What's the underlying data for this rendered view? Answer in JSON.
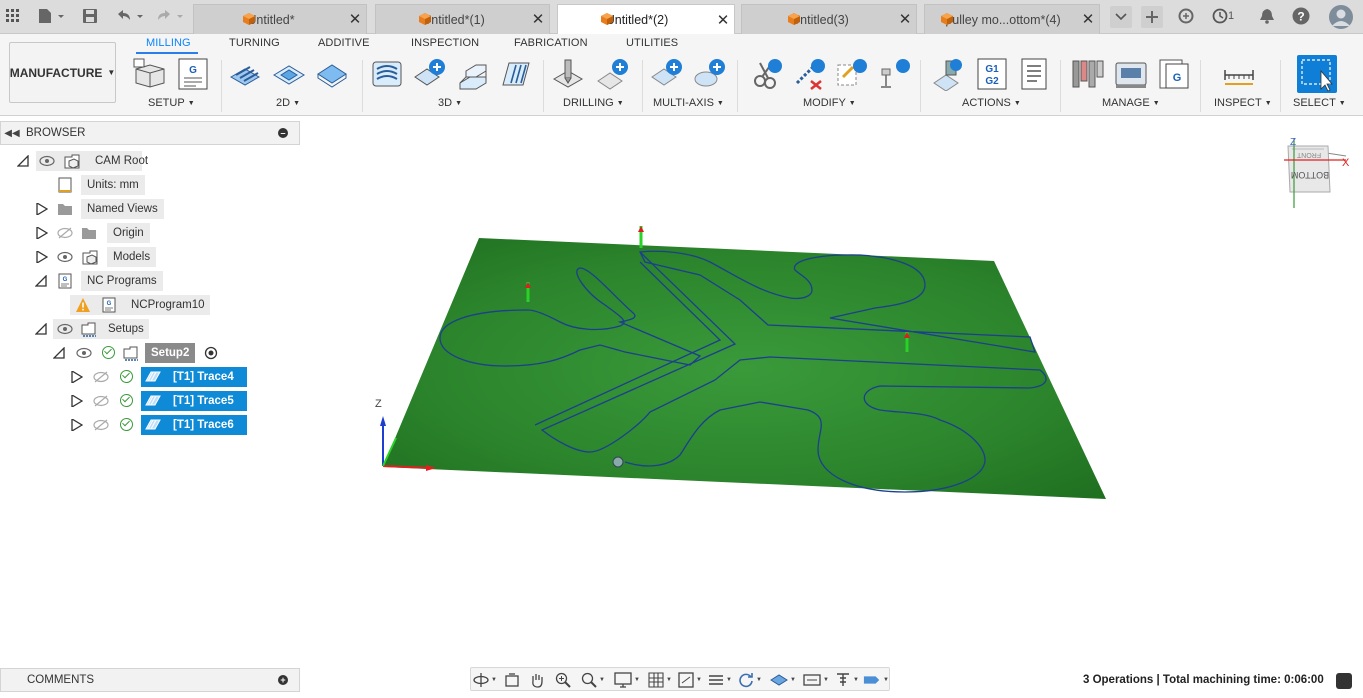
{
  "tabs": [
    {
      "label": "Untitled*",
      "active": false
    },
    {
      "label": "Untitled*(1)",
      "active": false
    },
    {
      "label": "Untitled*(2)",
      "active": true
    },
    {
      "label": "Untitled(3)",
      "active": false
    },
    {
      "label": "pulley mo...ottom*(4)",
      "active": false
    }
  ],
  "job_count": "1",
  "workspace": {
    "label": "MANUFACTURE"
  },
  "ribbon_tabs": [
    "MILLING",
    "TURNING",
    "ADDITIVE",
    "INSPECTION",
    "FABRICATION",
    "UTILITIES"
  ],
  "ribbon_active_tab": "MILLING",
  "groups": {
    "setup": "SETUP",
    "2d": "2D",
    "3d": "3D",
    "drilling": "DRILLING",
    "multiaxis": "MULTI-AXIS",
    "modify": "MODIFY",
    "actions": "ACTIONS",
    "manage": "MANAGE",
    "inspect": "INSPECT",
    "select": "SELECT"
  },
  "browser": {
    "title": "BROWSER",
    "root": "CAM Root",
    "units": "Units: mm",
    "named_views": "Named Views",
    "origin": "Origin",
    "models": "Models",
    "nc_programs": "NC Programs",
    "nc_program": "NCProgram10",
    "setups": "Setups",
    "setup2": "Setup2",
    "operations": [
      "[T1] Trace4",
      "[T1] Trace5",
      "[T1] Trace6"
    ]
  },
  "comments": {
    "title": "COMMENTS"
  },
  "status": "3 Operations | Total machining time: 0:06:00",
  "viewcube": {
    "face_label": "BOTTOM",
    "top_label": "FRONT",
    "axis_x": "X",
    "axis_z": "Z"
  },
  "triad": {
    "z_label": "Z"
  },
  "colors": {
    "accent": "#0a84ff",
    "selection": "#0e8ad6",
    "stock_green": "#2e8b2e",
    "toolpath": "#1c3f8f"
  }
}
